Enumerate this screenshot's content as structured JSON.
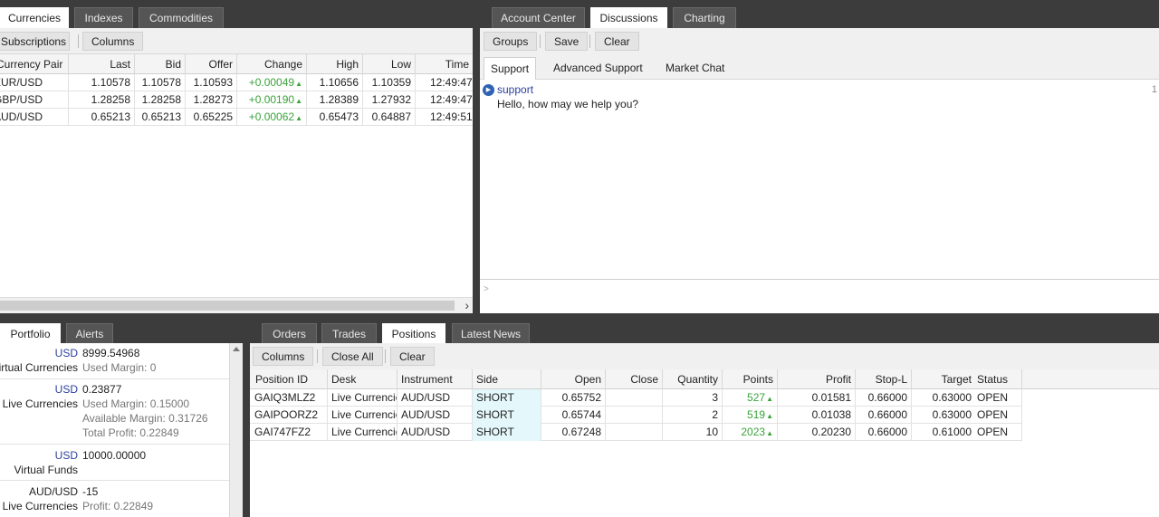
{
  "quotes_panel": {
    "tabs": [
      "Currencies",
      "Indexes",
      "Commodities"
    ],
    "toolbar": {
      "subscriptions": "Subscriptions",
      "columns": "Columns"
    },
    "headers": [
      "Currency Pair",
      "Last",
      "Bid",
      "Offer",
      "Change",
      "High",
      "Low",
      "Time"
    ],
    "rows": [
      {
        "pair": "EUR/USD",
        "last": "1.10578",
        "bid": "1.10578",
        "offer": "1.10593",
        "change": "+0.00049",
        "high": "1.10656",
        "low": "1.10359",
        "time": "12:49:47"
      },
      {
        "pair": "GBP/USD",
        "last": "1.28258",
        "bid": "1.28258",
        "offer": "1.28273",
        "change": "+0.00190",
        "high": "1.28389",
        "low": "1.27932",
        "time": "12:49:47"
      },
      {
        "pair": "AUD/USD",
        "last": "0.65213",
        "bid": "0.65213",
        "offer": "0.65225",
        "change": "+0.00062",
        "high": "0.65473",
        "low": "0.64887",
        "time": "12:49:51"
      }
    ],
    "scroll_right": "›"
  },
  "chat_panel": {
    "tabs": [
      "Account Center",
      "Discussions",
      "Charting"
    ],
    "toolbar": {
      "groups": "Groups",
      "save": "Save",
      "clear": "Clear"
    },
    "subtabs": [
      "Support",
      "Advanced Support",
      "Market Chat"
    ],
    "messages": [
      {
        "author": "support",
        "text": "Hello, how may we help you?",
        "time": "1"
      }
    ],
    "input_prompt": ">"
  },
  "portfolio_panel": {
    "tabs": [
      "Portfolio",
      "Alerts"
    ],
    "blocks": [
      {
        "currency": "USD",
        "amount": "8999.54968",
        "label": "Virtual Currencies",
        "details": [
          "Used Margin:  0"
        ]
      },
      {
        "currency": "USD",
        "amount": "0.23877",
        "label": "Live Currencies",
        "details": [
          "Used Margin:  0.15000",
          "Available Margin:  0.31726",
          "Total Profit:  0.22849"
        ]
      },
      {
        "currency": "USD",
        "amount": "10000.00000",
        "label": "Virtual Funds",
        "details": []
      },
      {
        "currency": "AUD/USD",
        "amount": "-15",
        "label": "Live Currencies",
        "details": [
          "Profit:  0.22849"
        ]
      }
    ]
  },
  "positions_panel": {
    "tabs": [
      "Orders",
      "Trades",
      "Positions",
      "Latest News"
    ],
    "toolbar": {
      "columns": "Columns",
      "close_all": "Close All",
      "clear": "Clear"
    },
    "headers": [
      "Position ID",
      "Desk",
      "Instrument",
      "Side",
      "Open",
      "Close",
      "Quantity",
      "Points",
      "Profit",
      "Stop-L",
      "Target",
      "Status"
    ],
    "rows": [
      {
        "id": "GAIQ3MLZ2",
        "desk": "Live Currencies",
        "instrument": "AUD/USD",
        "side": "SHORT",
        "open": "0.65752",
        "close": "",
        "qty": "3",
        "points": "527",
        "profit": "0.01581",
        "stop": "0.66000",
        "target": "0.63000",
        "status": "OPEN"
      },
      {
        "id": "GAIPOORZ2",
        "desk": "Live Currencies",
        "instrument": "AUD/USD",
        "side": "SHORT",
        "open": "0.65744",
        "close": "",
        "qty": "2",
        "points": "519",
        "profit": "0.01038",
        "stop": "0.66000",
        "target": "0.63000",
        "status": "OPEN"
      },
      {
        "id": "GAI747FZ2",
        "desk": "Live Currencies",
        "instrument": "AUD/USD",
        "side": "SHORT",
        "open": "0.67248",
        "close": "",
        "qty": "10",
        "points": "2023",
        "profit": "0.20230",
        "stop": "0.66000",
        "target": "0.61000",
        "status": "OPEN"
      }
    ]
  },
  "icons": {
    "up_arrow": "▲",
    "play_icon": "▶"
  },
  "colors": {
    "up": "#3aa33a",
    "currency": "#2c3f9c",
    "short_bg": "#e4f7fb"
  }
}
